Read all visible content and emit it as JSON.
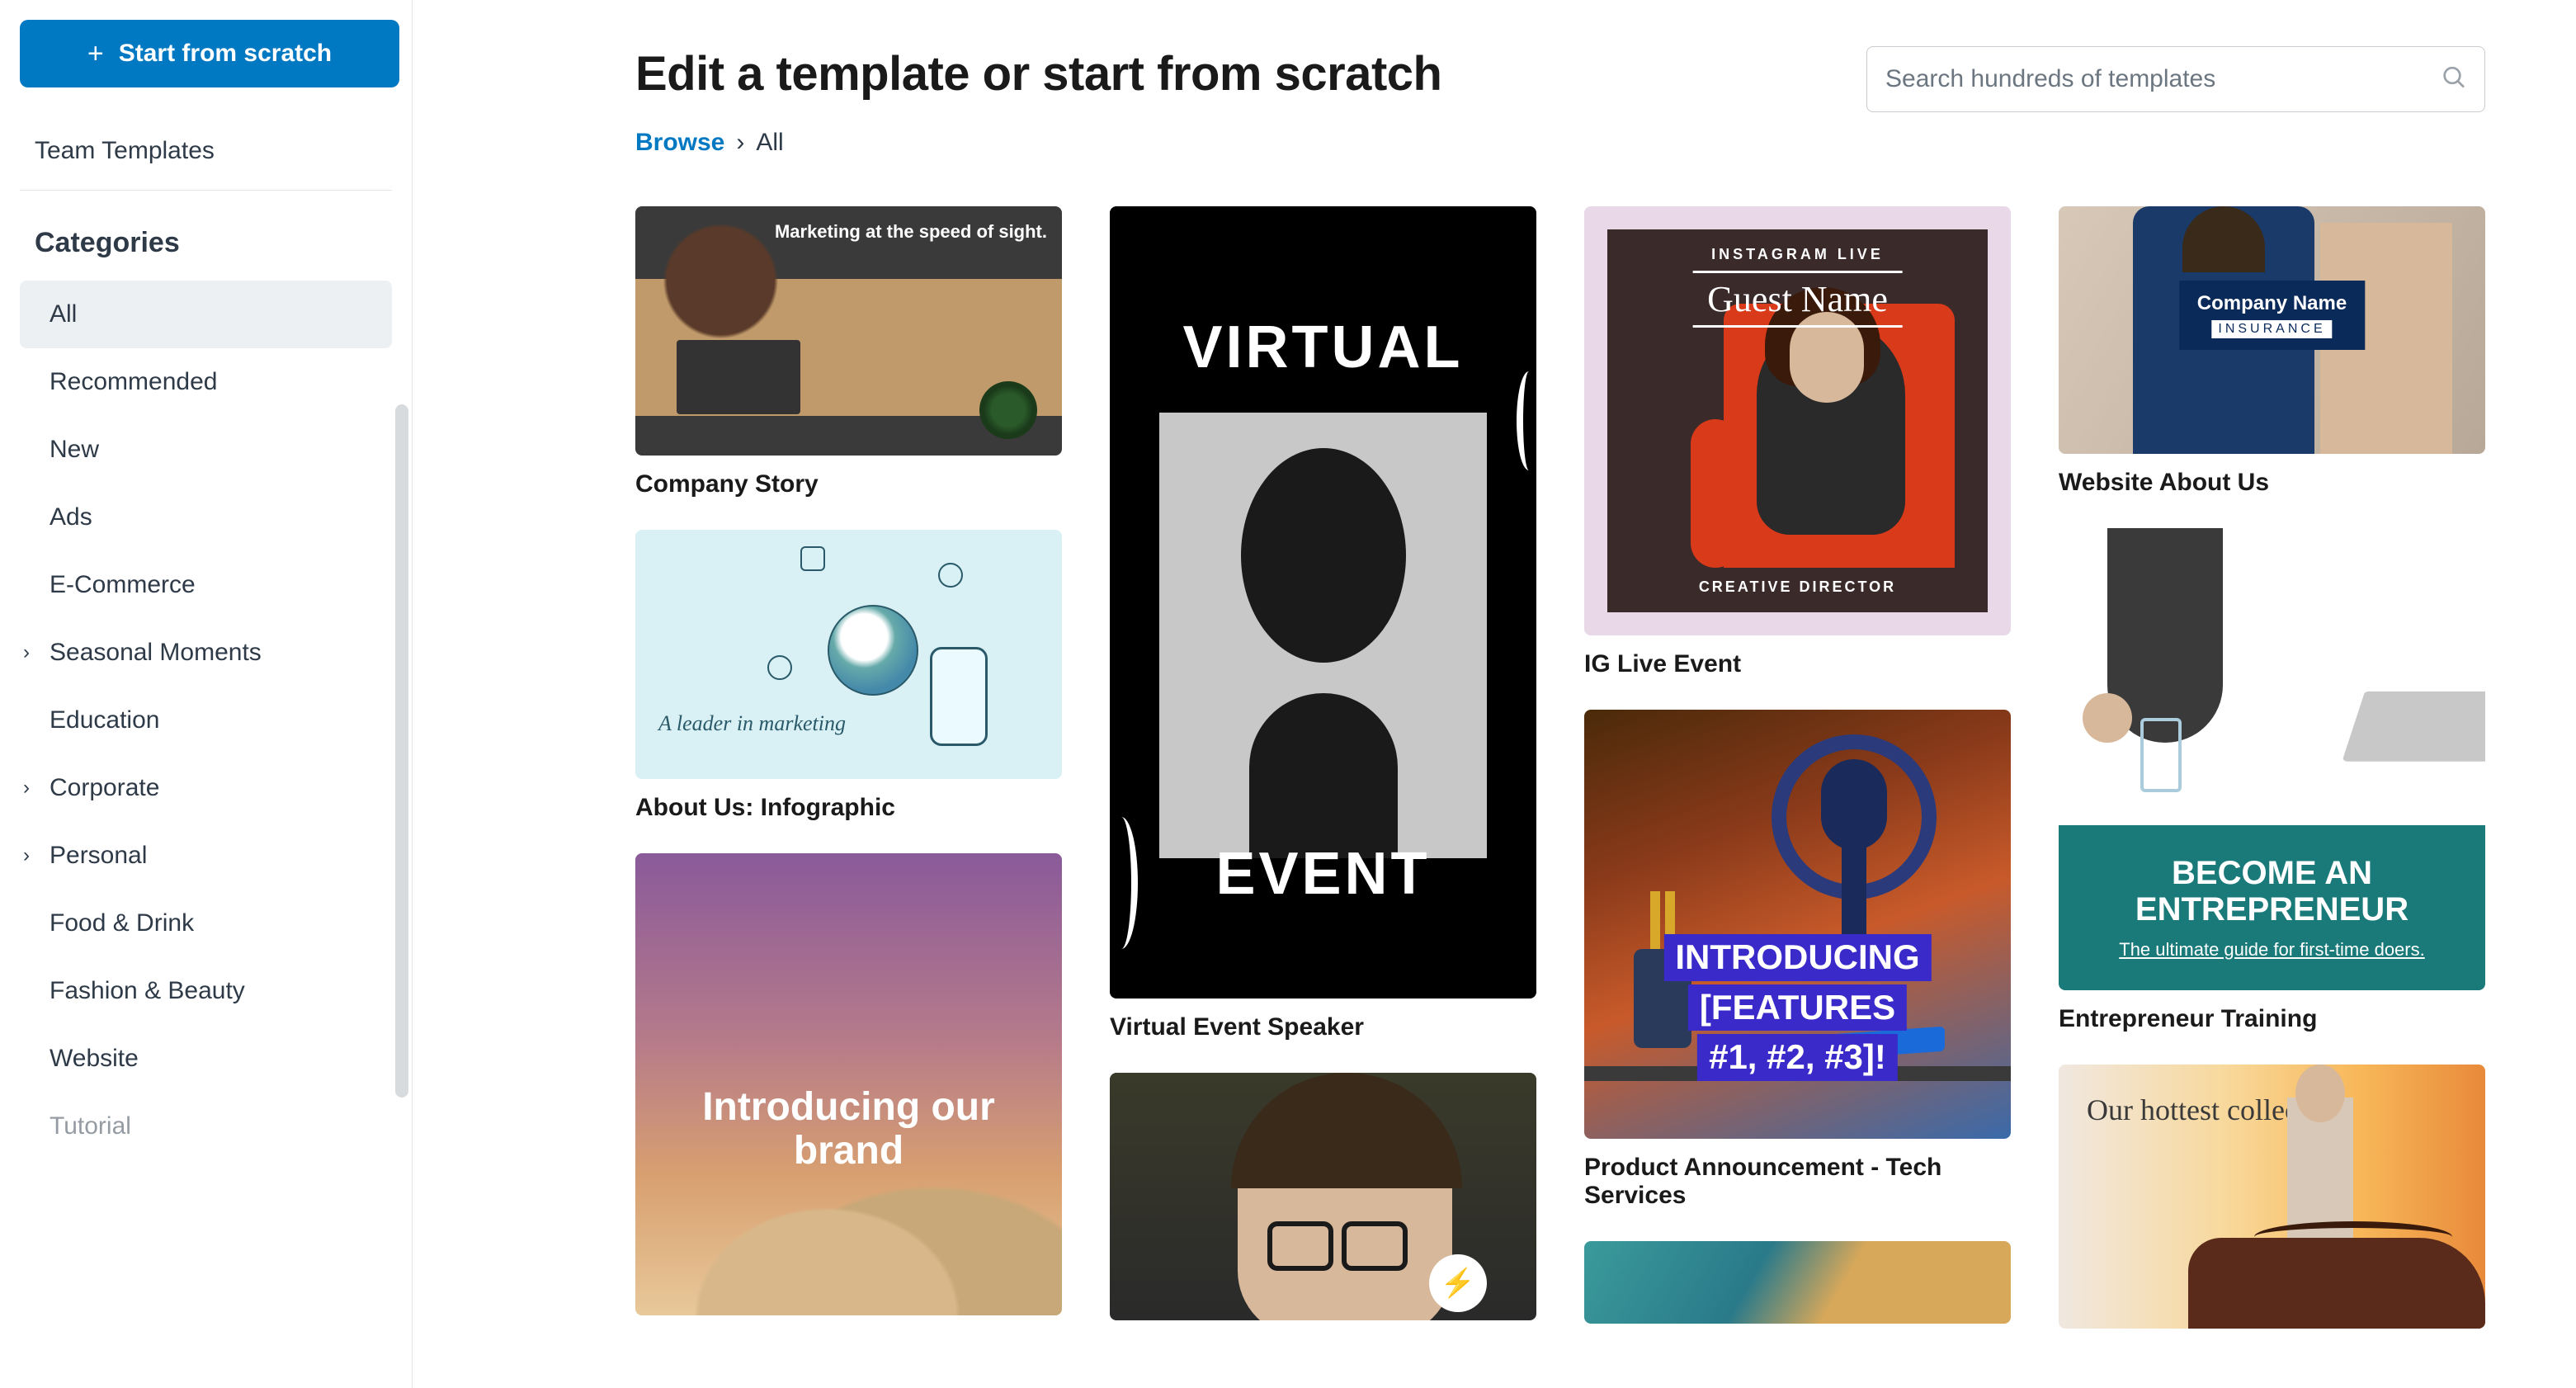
{
  "sidebar": {
    "start_button": "Start from scratch",
    "team_templates": "Team Templates",
    "categories_title": "Categories",
    "categories": [
      {
        "label": "All",
        "expandable": false,
        "active": true
      },
      {
        "label": "Recommended",
        "expandable": false,
        "active": false
      },
      {
        "label": "New",
        "expandable": false,
        "active": false
      },
      {
        "label": "Ads",
        "expandable": false,
        "active": false
      },
      {
        "label": "E-Commerce",
        "expandable": false,
        "active": false
      },
      {
        "label": "Seasonal Moments",
        "expandable": true,
        "active": false
      },
      {
        "label": "Education",
        "expandable": false,
        "active": false
      },
      {
        "label": "Corporate",
        "expandable": true,
        "active": false
      },
      {
        "label": "Personal",
        "expandable": true,
        "active": false
      },
      {
        "label": "Food & Drink",
        "expandable": false,
        "active": false
      },
      {
        "label": "Fashion & Beauty",
        "expandable": false,
        "active": false
      },
      {
        "label": "Website",
        "expandable": false,
        "active": false
      },
      {
        "label": "Tutorial",
        "expandable": false,
        "active": false
      }
    ]
  },
  "header": {
    "title": "Edit a template or start from scratch",
    "search_placeholder": "Search hundreds of templates"
  },
  "breadcrumb": {
    "root": "Browse",
    "current": "All"
  },
  "templates": {
    "col1": {
      "company_story": {
        "label": "Company Story",
        "overlay": "Marketing at the speed of sight."
      },
      "about_infographic": {
        "label": "About Us: Infographic",
        "overlay": "A leader in marketing"
      },
      "brand_intro": {
        "overlay": "Introducing our brand"
      }
    },
    "col2": {
      "virtual_event": {
        "label": "Virtual Event Speaker",
        "overlay_top": "VIRTUAL",
        "overlay_bottom": "EVENT"
      },
      "person_partial_badge": "⚡"
    },
    "col3": {
      "ig_live": {
        "label": "IG Live Event",
        "overlay_top": "INSTAGRAM LIVE",
        "overlay_name": "Guest Name",
        "overlay_role": "CREATIVE DIRECTOR"
      },
      "product_announce": {
        "label": "Product Announcement - Tech Services",
        "line1": "INTRODUCING",
        "line2": "[FEATURES",
        "line3": "#1, #2, #3]!"
      }
    },
    "col4": {
      "website_about": {
        "label": "Website About Us",
        "overlay_name": "Company Name",
        "overlay_sub": "INSURANCE"
      },
      "entrepreneur": {
        "label": "Entrepreneur Training",
        "headline": "BECOME AN ENTREPRENEUR",
        "sub": "The ultimate guide for first-time doers."
      },
      "collection": {
        "overlay": "Our hottest collection"
      }
    }
  }
}
